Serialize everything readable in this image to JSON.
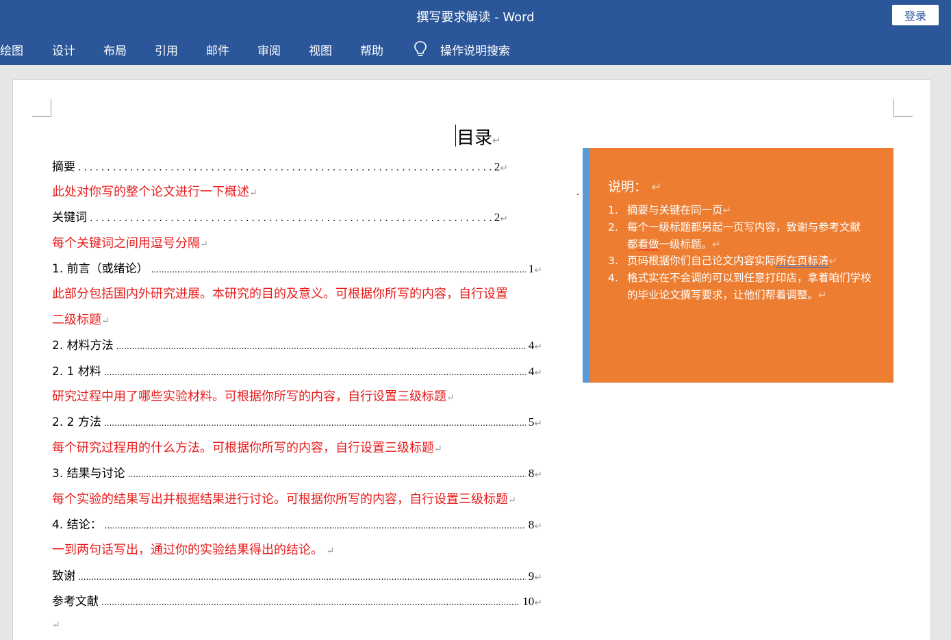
{
  "window": {
    "title": "撰写要求解读  -  Word",
    "login_label": "登录"
  },
  "ribbon": {
    "tabs": [
      "绘图",
      "设计",
      "布局",
      "引用",
      "邮件",
      "审阅",
      "视图",
      "帮助"
    ],
    "tell_me": "操作说明搜索",
    "tell_me_icon": "lightbulb-icon"
  },
  "document": {
    "toc_title": "目录",
    "paragraph_mark": "↵",
    "entries": [
      {
        "kind": "toc",
        "label": "摘要",
        "page": "2"
      },
      {
        "kind": "note",
        "text": "此处对你写的整个论文进行一下概述"
      },
      {
        "kind": "toc",
        "label": "关键词",
        "page": "2"
      },
      {
        "kind": "note",
        "text": "每个关键词之间用逗号分隔"
      },
      {
        "kind": "toc",
        "label": "1. 前言（或绪论）",
        "page": "1"
      },
      {
        "kind": "note",
        "text": "此部分包括国内外研究进展。本研究的目的及意义。可根据你所写的内容，自行设置"
      },
      {
        "kind": "note",
        "text": "二级标题"
      },
      {
        "kind": "toc",
        "label": "2. 材料方法",
        "page": "4"
      },
      {
        "kind": "toc",
        "label": "2. 1 材料",
        "page": "4"
      },
      {
        "kind": "note",
        "text": "研究过程中用了哪些实验材料。可根据你所写的内容，自行设置三级标题"
      },
      {
        "kind": "toc",
        "label": "2. 2 方法",
        "page": "5"
      },
      {
        "kind": "note",
        "text": "每个研究过程用的什么方法。可根据你所写的内容，自行设置三级标题"
      },
      {
        "kind": "toc",
        "label": "3. 结果与讨论",
        "page": "8"
      },
      {
        "kind": "note",
        "text": "每个实验的结果写出并根据结果进行讨论。可根据你所写的内容，自行设置三级标题"
      },
      {
        "kind": "toc",
        "label": "4. 结论：",
        "page": "8"
      },
      {
        "kind": "note",
        "text": "一到两句话写出，通过你的实验结果得出的结论。"
      },
      {
        "kind": "toc",
        "label": "致谢",
        "page": "9"
      },
      {
        "kind": "toc",
        "label": "参考文献",
        "page": "10"
      }
    ]
  },
  "note_box": {
    "title": "说明：",
    "fill_color": "#ed7d31",
    "bar_color": "#5b9bd5",
    "items": [
      {
        "num": "1.",
        "text": "摘要与关键在同一页"
      },
      {
        "num": "2.",
        "text_a": "每个一级标题都另起一页写内容，致谢与参考文献",
        "text_b1": "都",
        "text_b2": "看做",
        "text_b3": "一级标题。"
      },
      {
        "num": "3.",
        "text_a": "页码根据你们自己论文内容实际",
        "text_b": "所在页标清"
      },
      {
        "num": "4.",
        "text": "格式实在不会调的可以到任意打印店，拿着咱们学校的毕业论文撰写要求，让他们帮着调整。"
      }
    ]
  },
  "colors": {
    "accent": "#2b579a",
    "note_text": "#e81c1c"
  }
}
